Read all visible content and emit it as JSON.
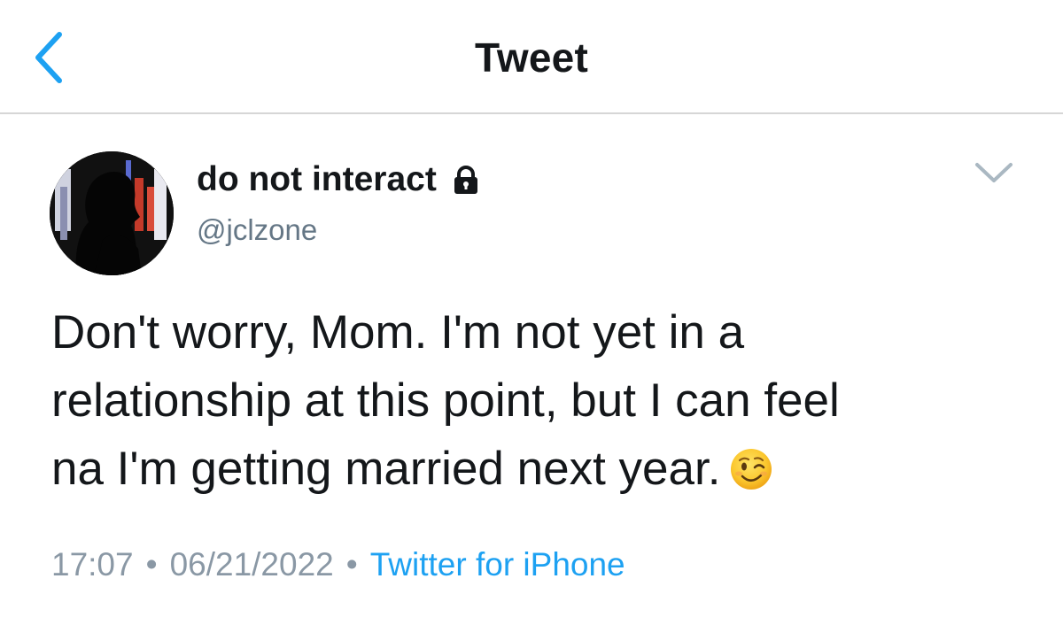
{
  "nav": {
    "title": "Tweet",
    "back_icon": "chevron-left-icon"
  },
  "tweet": {
    "display_name": "do not interact",
    "protected_icon": "lock-icon",
    "handle": "@jclzone",
    "more_icon": "chevron-down-icon",
    "text_lines": [
      "Don't worry, Mom. I'm not yet in a",
      "relationship at this point, but I can feel",
      "na I'm getting married next year."
    ],
    "emoji_icon": "winking-face-icon",
    "time": "17:07",
    "date": "06/21/2022",
    "separator": "•",
    "source": "Twitter for iPhone"
  },
  "colors": {
    "accent": "#1da1f2",
    "secondary_text": "#657786",
    "primary_text": "#14171a",
    "divider": "#d6d6d6"
  }
}
